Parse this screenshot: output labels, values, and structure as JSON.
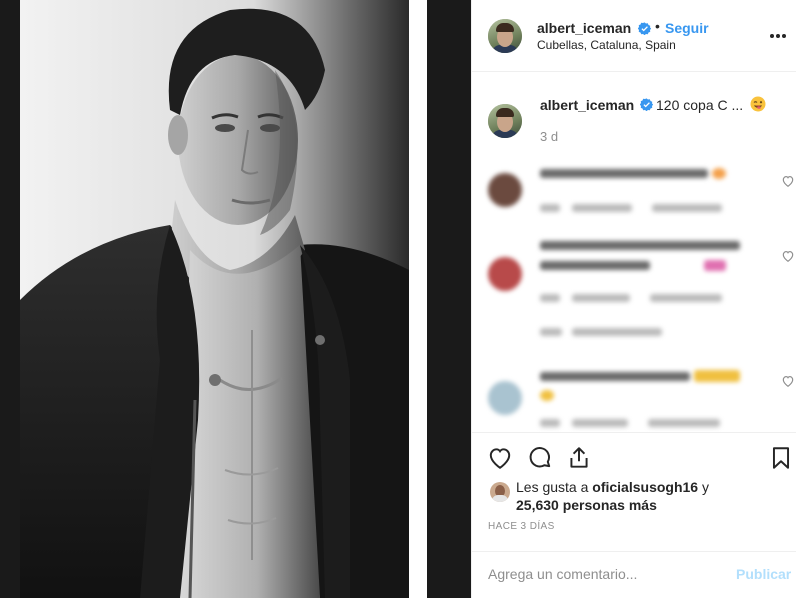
{
  "post": {
    "username": "albert_iceman",
    "follow_label": "Seguir",
    "separator": "•",
    "location": "Cubellas, Cataluna, Spain",
    "caption_text": "120 copa C ...",
    "caption_time": "3 d"
  },
  "likes": {
    "prefix": "Les gusta a ",
    "liker": "oficialsusogh16",
    "suffix": " y",
    "others": "25,630 personas más"
  },
  "post_date": "HACE 3 DÍAS",
  "comment_box": {
    "placeholder": "Agrega un comentario...",
    "publish_label": "Publicar"
  },
  "colors": {
    "accent": "#3897f0",
    "publish_disabled": "#b2dffc",
    "muted": "#8e8e8e"
  },
  "icons": [
    "verified-badge-icon",
    "more-options-icon",
    "heart-icon",
    "comment-icon",
    "share-icon",
    "bookmark-icon",
    "winking-face-emoji"
  ]
}
